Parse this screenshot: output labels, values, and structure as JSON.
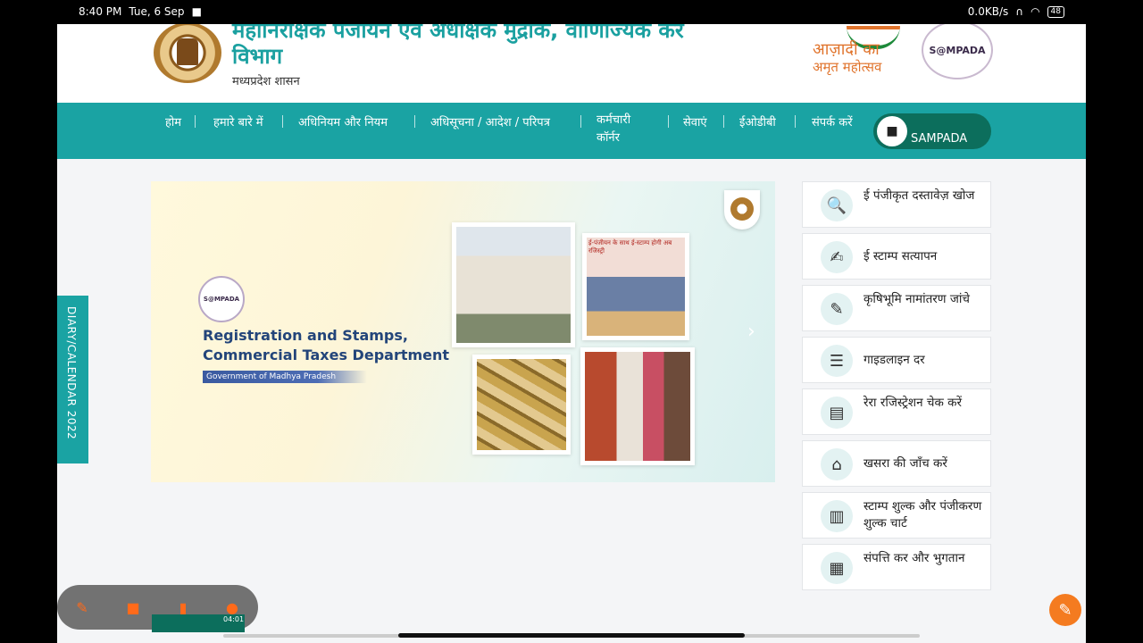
{
  "status_bar": {
    "time": "8:40 PM",
    "date": "Tue, 6 Sep",
    "net_speed": "0.0KB/s",
    "battery": "48"
  },
  "header": {
    "dept_line1": "महानिरीक्षक पंजीयन एवं अधीक्षक मुद्रांक, वाणिज्यिक कर",
    "dept_line2": "विभाग",
    "dept_sub": "मध्यप्रदेश शासन",
    "azadi_line1": "आज़ादी का",
    "azadi_line2": "अमृत महोत्सव",
    "sampada_logo": "S@MPADA"
  },
  "nav": {
    "items": [
      "होम",
      "हमारे बारे में",
      "अधिनियम और नियम",
      "अधिसूचना / आदेश / परिपत्र",
      "कर्मचारी कॉर्नर",
      "सेवाएं",
      "ईओडीबी",
      "संपर्क करें"
    ],
    "sampada_button": "SAMPADA"
  },
  "side_tab": {
    "label": "DIARY/CALENDAR 2022"
  },
  "banner": {
    "badge": "S@MPADA",
    "title_line1": "Registration and Stamps,",
    "title_line2": "Commercial Taxes Department",
    "gov_label": "Government of Madhya Pradesh",
    "photo_caption": "ई-पंजीयन के साथ ई-स्टाम्प होगी अब रजिस्ट्री"
  },
  "services": [
    {
      "icon": "document-search-icon",
      "label": "ई पंजीकृत दस्तावेज़ खोज"
    },
    {
      "icon": "stamp-verify-icon",
      "label": "ई स्टाम्प सत्यापन"
    },
    {
      "icon": "land-mutation-icon",
      "label": "कृषिभूमि नामांतरण जांचे"
    },
    {
      "icon": "guideline-icon",
      "label": "गाइडलाइन दर"
    },
    {
      "icon": "rera-check-icon",
      "label": "रेरा रजिस्ट्रेशन चेक करें"
    },
    {
      "icon": "khasra-icon",
      "label": "खसरा की जाँच करें"
    },
    {
      "icon": "fee-chart-icon",
      "label": "स्टाम्प शुल्क और पंजीकरण शुल्क चार्ट"
    },
    {
      "icon": "property-tax-icon",
      "label": "संपत्ति कर और भुगतान"
    }
  ],
  "overlay": {
    "thumb_time": "04:01"
  },
  "colors": {
    "teal": "#1aa3a3",
    "dark_green": "#0c6e5c",
    "orange": "#f47b20"
  }
}
